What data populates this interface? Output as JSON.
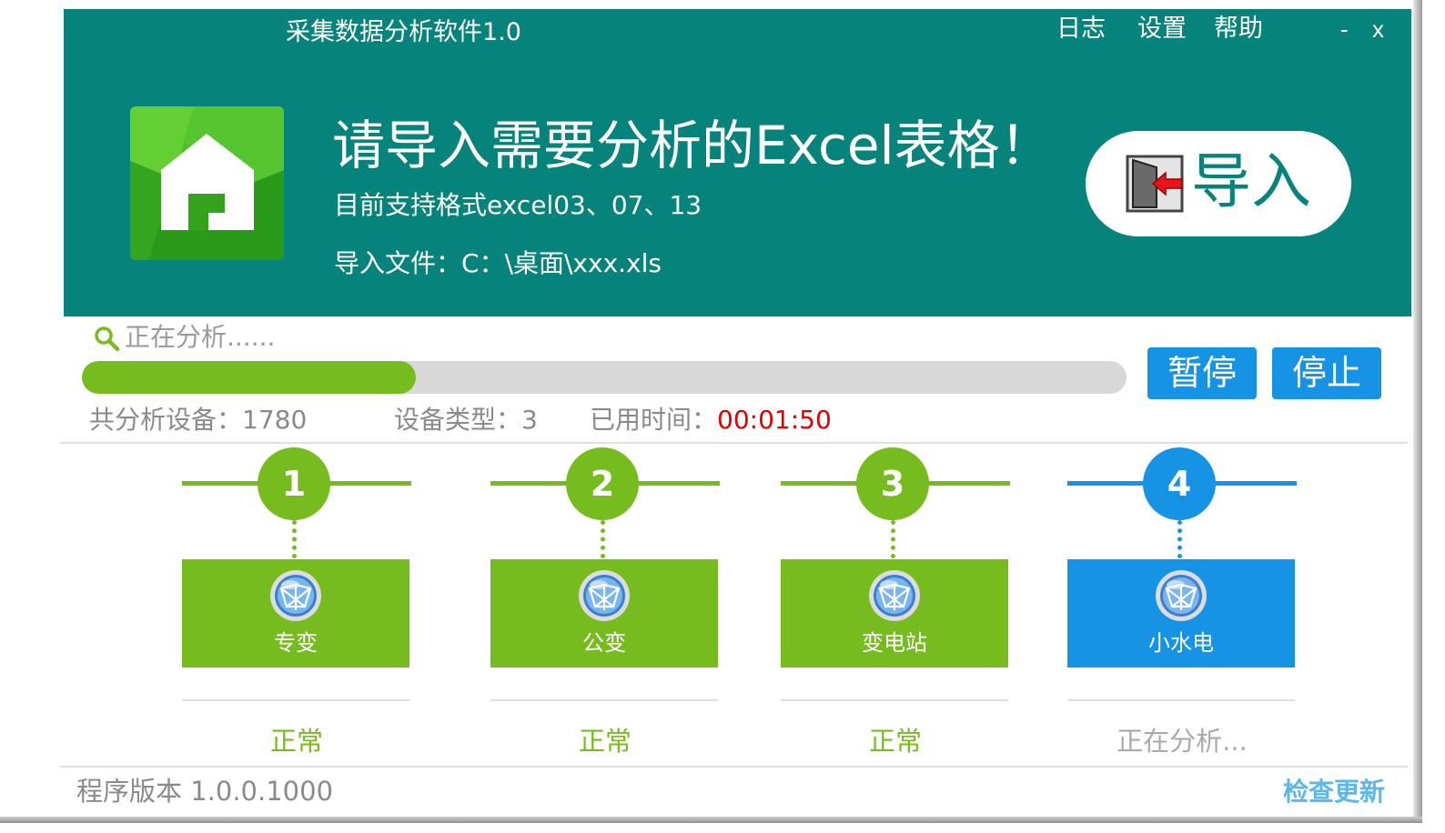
{
  "app": {
    "title": "采集数据分析软件1.0"
  },
  "menu": {
    "log": "日志",
    "settings": "设置",
    "help": "帮助",
    "minimize": "-",
    "close": "x"
  },
  "banner": {
    "headline": "请导入需要分析的Excel表格！",
    "formats": "目前支持格式excel03、07、13",
    "file_label": "导入文件：",
    "file_path": "C：\\桌面\\xxx.xls",
    "import_label": "导入"
  },
  "analysis": {
    "status": "正在分析......",
    "progress": 0.32,
    "pause_label": "暂停",
    "stop_label": "停止",
    "devices_label": "共分析设备：",
    "devices_value": "1780",
    "types_label": "设备类型：",
    "types_value": "3",
    "elapsed_label": "已用时间：",
    "elapsed_value": "00:01:50"
  },
  "steps": [
    {
      "number": "1",
      "name": "专变",
      "state": "正常"
    },
    {
      "number": "2",
      "name": "公变",
      "state": "正常"
    },
    {
      "number": "3",
      "name": "变电站",
      "state": "正常"
    },
    {
      "number": "4",
      "name": "小水电",
      "state": "正在分析..."
    }
  ],
  "colors": {
    "green": "#77bc1f",
    "blue": "#1793e6",
    "teal": "#06837a",
    "muted": "#aaaaaa"
  },
  "footer": {
    "version": "程序版本 1.0.0.1000",
    "check_update": "检查更新"
  }
}
